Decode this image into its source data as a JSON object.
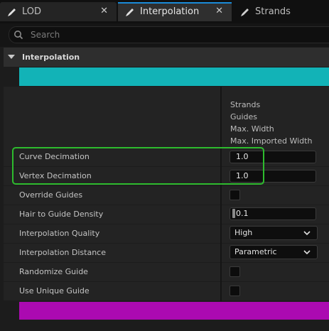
{
  "tabs": [
    {
      "label": "LOD",
      "close": "✕"
    },
    {
      "label": "Interpolation",
      "close": "✕"
    },
    {
      "label": "Strands"
    }
  ],
  "search": {
    "placeholder": "Search"
  },
  "category": {
    "label": "Interpolation"
  },
  "headers": [
    "Strands",
    "Guides",
    "Max. Width",
    "Max. Imported Width"
  ],
  "rows": {
    "curve_decimation": {
      "label": "Curve Decimation",
      "value": "1.0"
    },
    "vertex_decimation": {
      "label": "Vertex Decimation",
      "value": "1.0"
    },
    "override_guides": {
      "label": "Override Guides",
      "checked": false
    },
    "hair_to_guide_density": {
      "label": "Hair to Guide Density",
      "value": "0.1"
    },
    "interpolation_quality": {
      "label": "Interpolation Quality",
      "value": "High"
    },
    "interpolation_distance": {
      "label": "Interpolation Distance",
      "value": "Parametric"
    },
    "randomize_guide": {
      "label": "Randomize Guide",
      "checked": false
    },
    "use_unique_guide": {
      "label": "Use Unique Guide",
      "checked": false
    }
  },
  "colors": {
    "group_color_top": "#12b3b7",
    "group_color_bottom": "#ab0ab1",
    "highlight": "#2dbb2d",
    "tab_accent": "#1a8bd8"
  },
  "icons": {
    "tab_icon": "pencil-icon",
    "search_icon": "search-icon",
    "dropdown_icon": "chevron-down-icon"
  }
}
